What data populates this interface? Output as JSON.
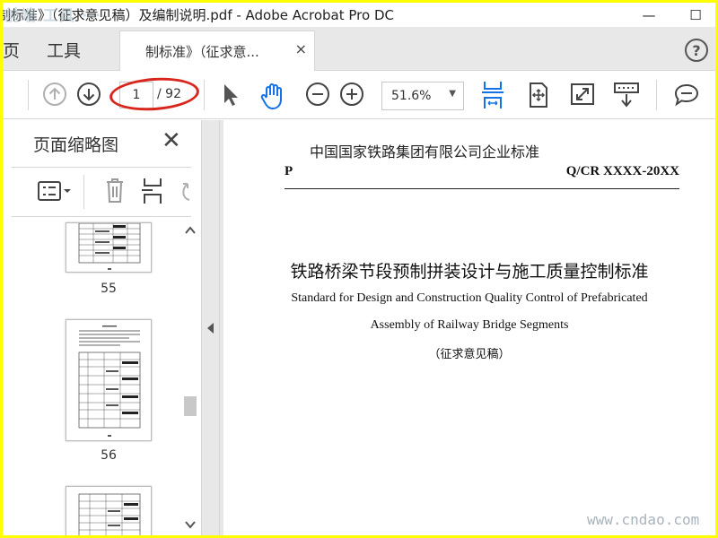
{
  "window": {
    "title": "制标准》（征求意见稿）及编制说明.pdf - Adobe Acrobat Pro DC",
    "minimize_glyph": "—",
    "maximize_glyph": "☐"
  },
  "menu": {
    "home_label": "页",
    "tools_label": "工具",
    "doc_tab_label": "制标准》（征求意...",
    "tab_close_glyph": "×",
    "help_glyph": "?"
  },
  "toolbar": {
    "current_page": "1",
    "total_pages": "/ 92",
    "zoom_value": "51.6%",
    "zoom_caret": "▼"
  },
  "left_panel": {
    "title": "页面缩略图",
    "close_glyph": "✕",
    "thumbnails": [
      {
        "page_label": "55"
      },
      {
        "page_label": "56"
      },
      {
        "page_label": ""
      }
    ]
  },
  "document": {
    "org": "中国国家铁路集团有限公司企业标准",
    "p_letter": "P",
    "std_code": "Q/CR  XXXX-20XX",
    "title_cn": "铁路桥梁节段预制拼装设计与施工质量控制标准",
    "title_en_line1": "Standard for Design and Construction Quality Control of Prefabricated",
    "title_en_line2": "Assembly of Railway Bridge Segments",
    "draft_label": "（征求意见稿）"
  },
  "watermarks": {
    "top": "前端 工具 ···",
    "bottom": "www.cndao.com"
  },
  "colors": {
    "frame": "#ffff00",
    "annotation_ellipse": "#d9261c",
    "accent_blue": "#1473e6",
    "chrome_gray": "#e8e8e8"
  },
  "icons": [
    "page-up-icon",
    "page-down-icon",
    "select-arrow-icon",
    "hand-tool-icon",
    "zoom-out-icon",
    "zoom-in-icon",
    "fit-page-icon",
    "rotate-view-icon",
    "full-screen-icon",
    "keyboard-scroll-icon",
    "comment-icon",
    "options-icon",
    "delete-icon",
    "insert-page-icon",
    "undo-icon"
  ]
}
